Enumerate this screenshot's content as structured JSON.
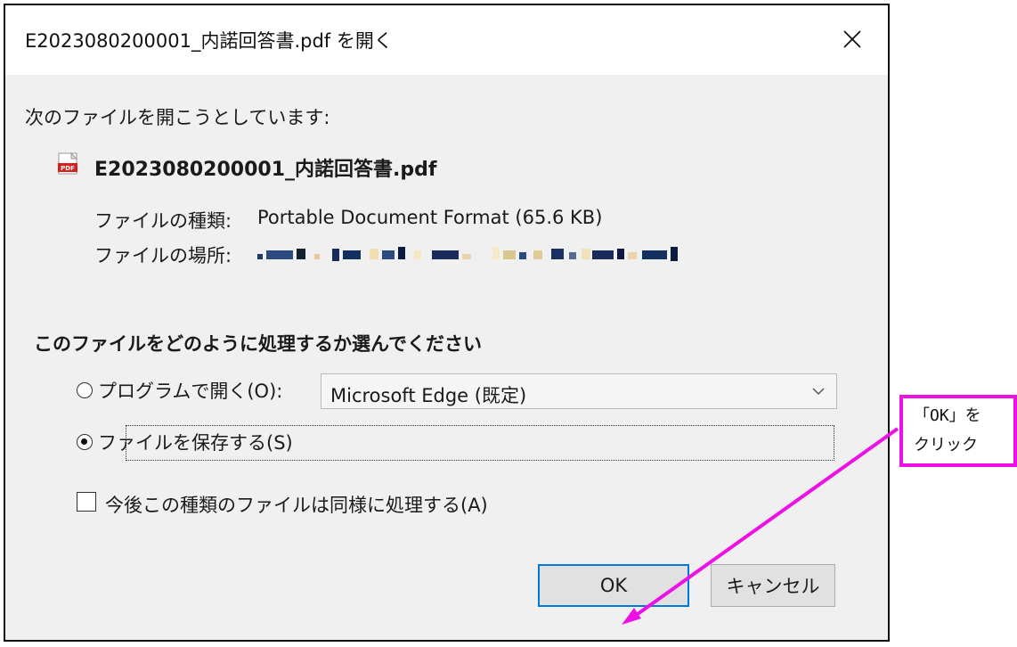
{
  "dialog": {
    "title": "E2023080200001_内諾回答書.pdf を開く",
    "intro": "次のファイルを開こうとしています:",
    "filename": "E2023080200001_内諾回答書.pdf",
    "file_type_label": "ファイルの種類:",
    "file_type_value": "Portable Document Format (65.6 KB)",
    "file_location_label": "ファイルの場所:",
    "question": "このファイルをどのように処理するか選んでください",
    "option_open": "プログラムで開く(O):",
    "program_select_value": "Microsoft Edge (既定)",
    "option_save": "ファイルを保存する(S)",
    "option_remember": "今後この種類のファイルは同様に処理する(A)",
    "ok_label": "OK",
    "cancel_label": "キャンセル",
    "selected_option": "save"
  },
  "callout": {
    "line1": "「OK」を",
    "line2": "クリック",
    "color": "#ee11e6"
  },
  "colors": {
    "focus_blue": "#0078d7",
    "pdf_red": "#d71f1f"
  }
}
